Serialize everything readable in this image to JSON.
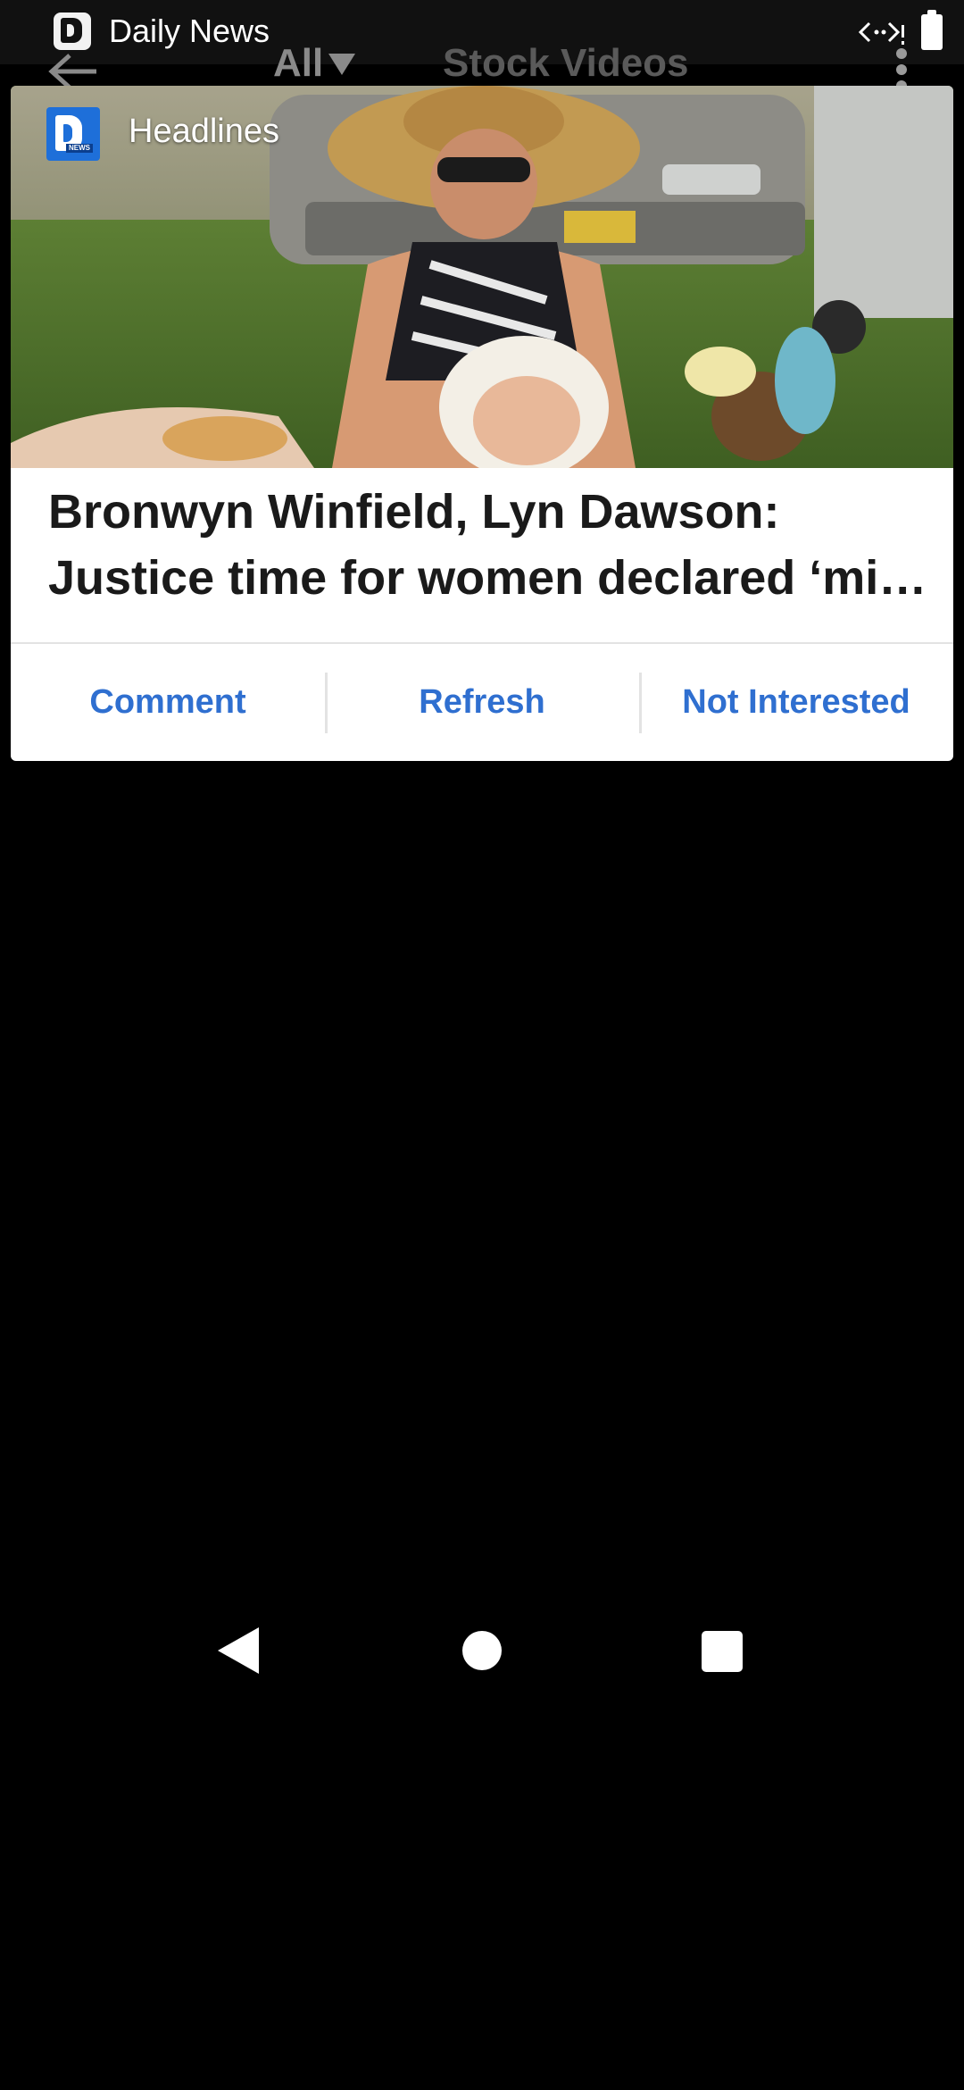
{
  "status_bar": {
    "notification_title": "Daily News",
    "icons": [
      "daily-news-app-icon",
      "cast-icon",
      "battery-icon"
    ]
  },
  "app_bar": {
    "filter_label": "All",
    "tab_title": "Stock Videos"
  },
  "card": {
    "source_name": "Headlines",
    "headline_line1": "Bronwyn Winfield, Lyn Dawson:",
    "headline_line2": "Justice time for women declared ‘mi…",
    "actions": {
      "comment": "Comment",
      "refresh": "Refresh",
      "not_interested": "Not Interested"
    }
  },
  "colors": {
    "accent": "#2f6fd0",
    "logo_blue": "#1e6fd9",
    "background": "#000000"
  }
}
